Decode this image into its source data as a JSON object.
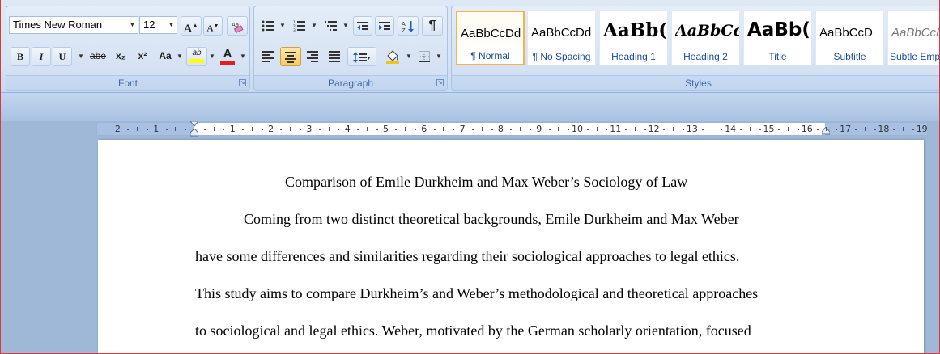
{
  "font": {
    "name": "Times New Roman",
    "size": "12",
    "group_label": "Font",
    "grow_label": "A",
    "shrink_label": "A",
    "bold": "B",
    "italic": "I",
    "underline": "U",
    "strike": "abe",
    "subscript": "x₂",
    "superscript": "x²",
    "case": "Aa",
    "highlight": "ab",
    "font_color": "A",
    "highlight_color": "#ffff00",
    "font_color_bar": "#e02020"
  },
  "paragraph": {
    "group_label": "Paragraph",
    "pilcrow": "¶"
  },
  "styles": {
    "group_label": "Styles",
    "items": [
      {
        "sample": "AaBbCcDd",
        "name": "¶ Normal"
      },
      {
        "sample": "AaBbCcDd",
        "name": "¶ No Spacing"
      },
      {
        "sample": "AaBb(",
        "name": "Heading 1"
      },
      {
        "sample": "AaBbCc",
        "name": "Heading 2"
      },
      {
        "sample": "AaBb(",
        "name": "Title"
      },
      {
        "sample": "AaBbCcD",
        "name": "Subtitle"
      },
      {
        "sample": "AaBbCcD",
        "name": "Subtle Emp"
      }
    ]
  },
  "ruler": {
    "left_numbers": [
      "2",
      "1"
    ],
    "numbers": [
      "1",
      "2",
      "3",
      "4",
      "5",
      "6",
      "7",
      "8",
      "9",
      "10",
      "11",
      "12",
      "13",
      "14",
      "15",
      "16",
      "17",
      "18",
      "19"
    ]
  },
  "document": {
    "title": "Comparison of Emile Durkheim and Max Weber’s Sociology of Law",
    "lines": [
      "Coming from two distinct theoretical backgrounds, Emile Durkheim and Max Weber",
      "have some differences and similarities regarding their sociological approaches to legal ethics.",
      "This study aims to compare Durkheim’s and Weber’s methodological and theoretical approaches",
      "to sociological and legal ethics. Weber, motivated by the German scholarly orientation, focused"
    ]
  }
}
